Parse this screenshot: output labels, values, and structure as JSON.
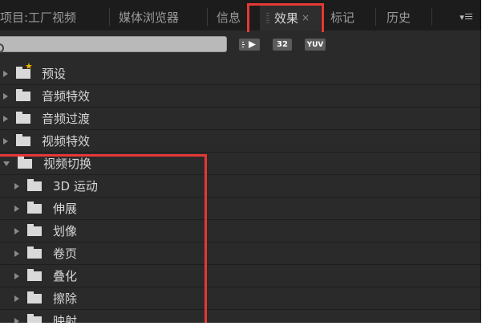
{
  "tabs": [
    {
      "label": "项目:工厂视频",
      "active": false
    },
    {
      "label": "媒体浏览器",
      "active": false
    },
    {
      "label": "信息",
      "active": false
    },
    {
      "label": "效果",
      "active": true,
      "close": "×"
    },
    {
      "label": "标记",
      "active": false
    },
    {
      "label": "历史",
      "active": false
    }
  ],
  "panel_menu": {
    "icon": "panel-menu-icon",
    "glyph": "▾"
  },
  "search": {
    "value": "",
    "placeholder": ""
  },
  "toolbar": {
    "accelerated_label": "",
    "bit32_label": "32",
    "yuv_label": "YUV"
  },
  "tree": [
    {
      "label": "预设",
      "expanded": false,
      "level": 0,
      "icon": "preset-folder-icon"
    },
    {
      "label": "音频特效",
      "expanded": false,
      "level": 0,
      "icon": "folder-icon"
    },
    {
      "label": "音频过渡",
      "expanded": false,
      "level": 0,
      "icon": "folder-icon"
    },
    {
      "label": "视频特效",
      "expanded": false,
      "level": 0,
      "icon": "folder-icon"
    },
    {
      "label": "视频切换",
      "expanded": true,
      "level": 0,
      "icon": "folder-icon"
    },
    {
      "label": "3D 运动",
      "expanded": false,
      "level": 1,
      "icon": "folder-icon"
    },
    {
      "label": "伸展",
      "expanded": false,
      "level": 1,
      "icon": "folder-icon"
    },
    {
      "label": "划像",
      "expanded": false,
      "level": 1,
      "icon": "folder-icon"
    },
    {
      "label": "卷页",
      "expanded": false,
      "level": 1,
      "icon": "folder-icon"
    },
    {
      "label": "叠化",
      "expanded": false,
      "level": 1,
      "icon": "folder-icon"
    },
    {
      "label": "擦除",
      "expanded": false,
      "level": 1,
      "icon": "folder-icon"
    },
    {
      "label": "映射",
      "expanded": false,
      "level": 1,
      "icon": "folder-icon"
    }
  ],
  "colors": {
    "highlight": "#e53935",
    "background": "#2a2a2a",
    "tabbar": "#1c1c1c",
    "star": "#f2b600"
  }
}
